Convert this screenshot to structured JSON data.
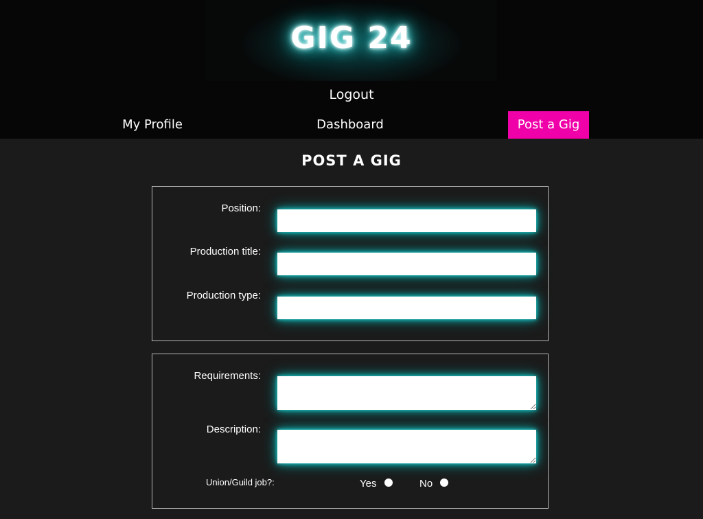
{
  "header": {
    "logo": "GIG 24",
    "logout": "Logout"
  },
  "nav": {
    "my_profile": "My Profile",
    "dashboard": "Dashboard",
    "post_a_gig": "Post a Gig",
    "active_color": "#f000a8"
  },
  "page": {
    "title": "POST A GIG"
  },
  "form": {
    "position_label": "Position:",
    "position_value": "",
    "production_title_label": "Production title:",
    "production_title_value": "",
    "production_type_label": "Production type:",
    "production_type_value": "",
    "requirements_label": "Requirements:",
    "requirements_value": "",
    "description_label": "Description:",
    "description_value": "",
    "union_label": "Union/Guild job?:",
    "yes_label": "Yes",
    "no_label": "No",
    "union_selected": null
  },
  "theme": {
    "glow_color": "#22cccc",
    "background": "#1b1b1b",
    "header_background": "#060606"
  }
}
